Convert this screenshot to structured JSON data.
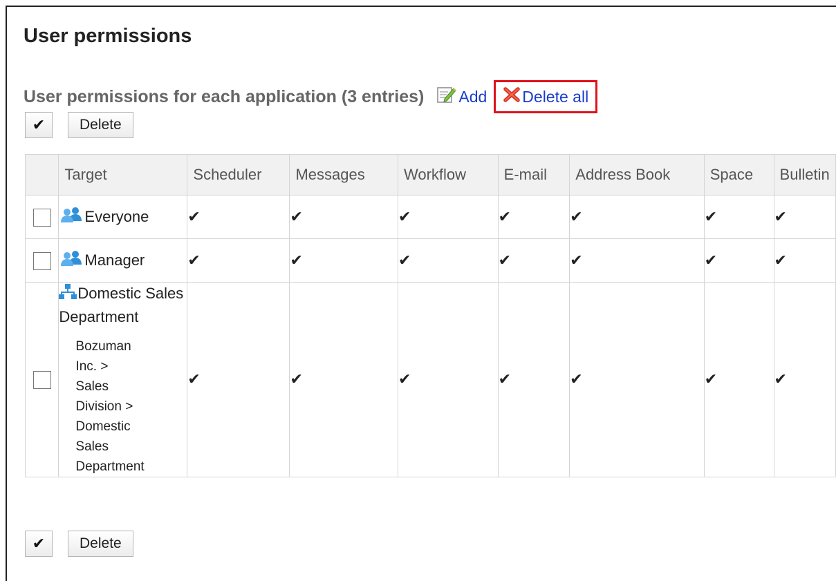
{
  "page": {
    "title": "User permissions"
  },
  "section": {
    "title": "User permissions for each application (3 entries)",
    "add_label": "Add",
    "delete_all_label": "Delete all"
  },
  "toolbar": {
    "check_all_glyph": "✔",
    "delete_label": "Delete"
  },
  "table": {
    "columns": [
      "Target",
      "Scheduler",
      "Messages",
      "Workflow",
      "E-mail",
      "Address Book",
      "Space",
      "Bulletin"
    ],
    "check_glyph": "✔",
    "rows": [
      {
        "target": "Everyone",
        "target_type": "role",
        "permissions": [
          true,
          true,
          true,
          true,
          true,
          true,
          true
        ]
      },
      {
        "target": "Manager",
        "target_type": "role",
        "permissions": [
          true,
          true,
          true,
          true,
          true,
          true,
          true
        ]
      },
      {
        "target": "Domestic Sales Department",
        "target_type": "organization",
        "path_lines": [
          "Bozuman",
          "Inc. >",
          "Sales",
          "Division >",
          "Domestic",
          "Sales",
          "Department"
        ],
        "permissions": [
          true,
          true,
          true,
          true,
          true,
          true,
          true
        ]
      }
    ]
  },
  "colors": {
    "link": "#1a3ccc",
    "highlight_border": "#e0121b",
    "header_bg": "#f1f1f1",
    "icon_blue": "#3d9be0"
  },
  "icons": {
    "add": "edit-pencil-icon",
    "delete_all": "red-x-icon",
    "role": "user-group-icon",
    "organization": "org-tree-icon"
  }
}
